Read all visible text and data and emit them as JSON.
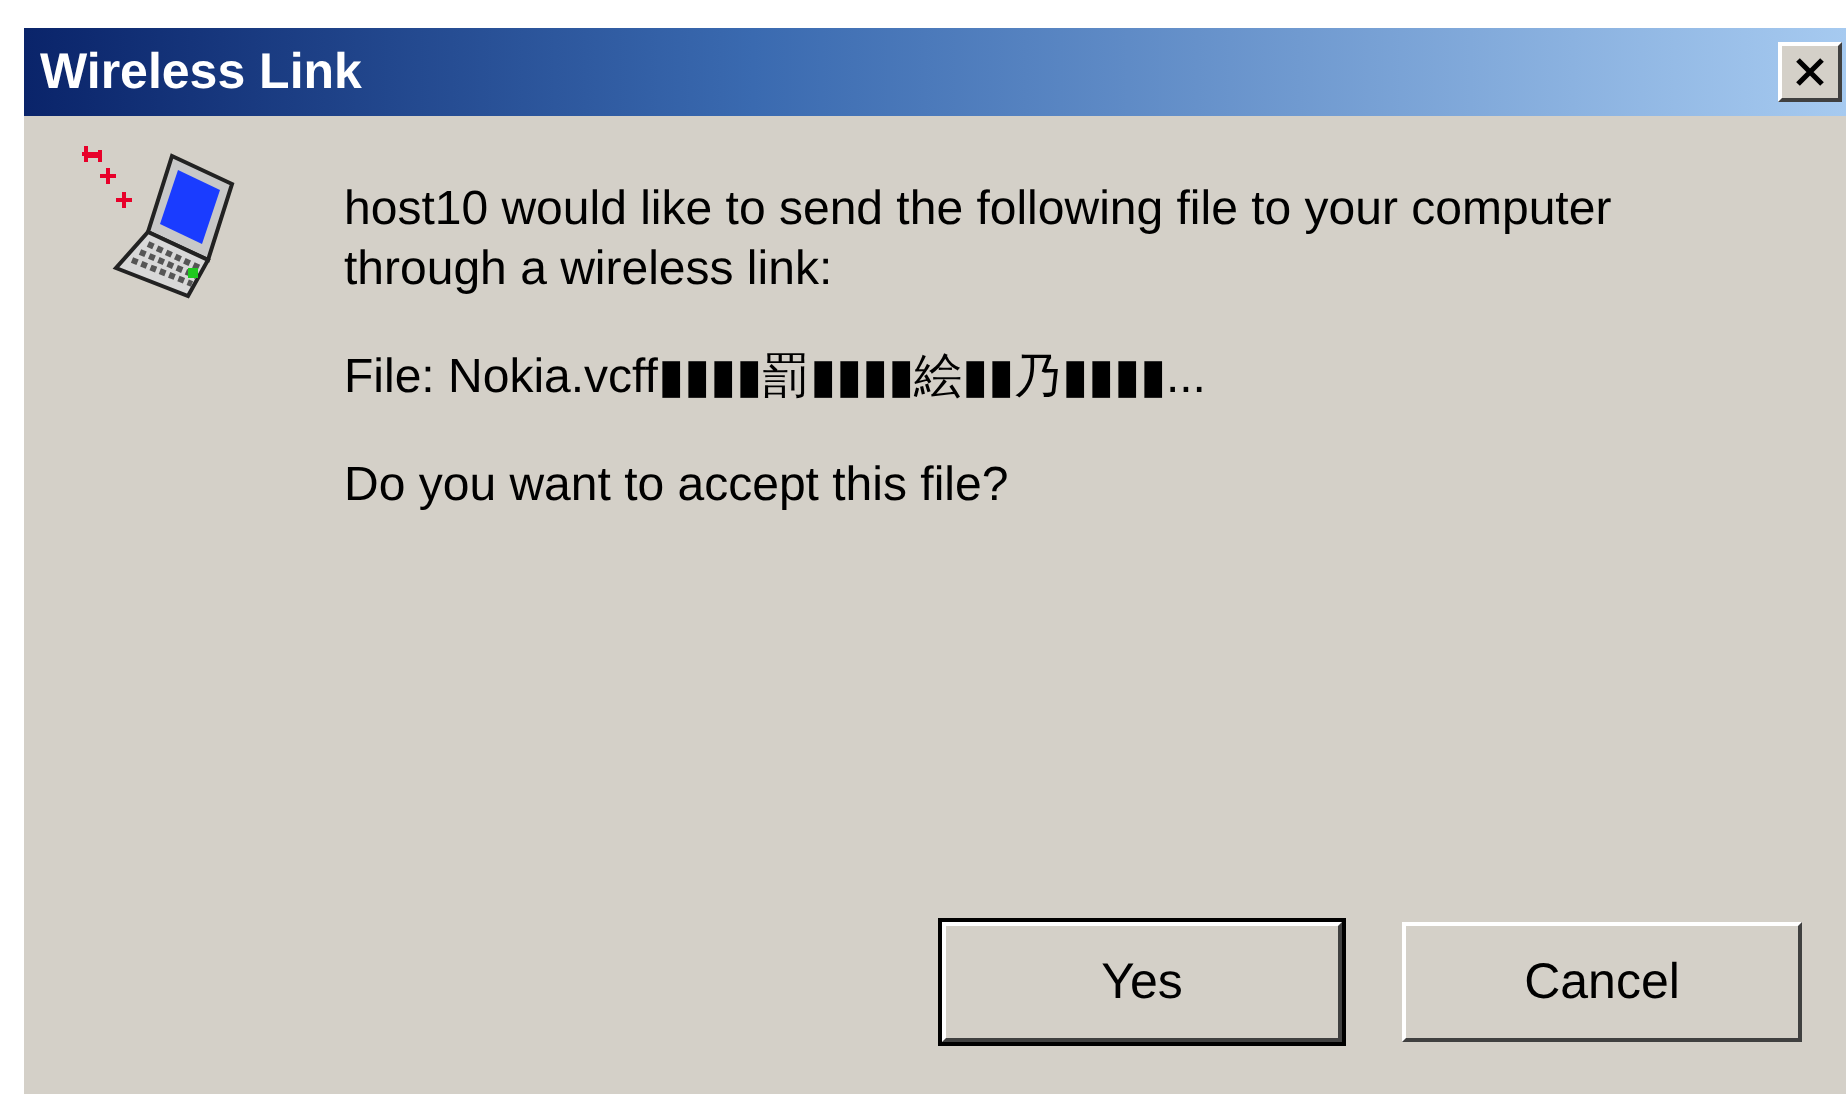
{
  "window": {
    "title": "Wireless Link"
  },
  "message": {
    "lines": [
      "host10 would like to send the following file to your computer through a wireless link:",
      "File: Nokia.vcff▮▮▮▮罰▮▮▮▮絵▮▮乃▮▮▮▮...",
      "Do you want to accept this file?"
    ]
  },
  "buttons": [
    {
      "label": "Yes",
      "default": true
    },
    {
      "label": "Cancel",
      "default": false
    }
  ]
}
